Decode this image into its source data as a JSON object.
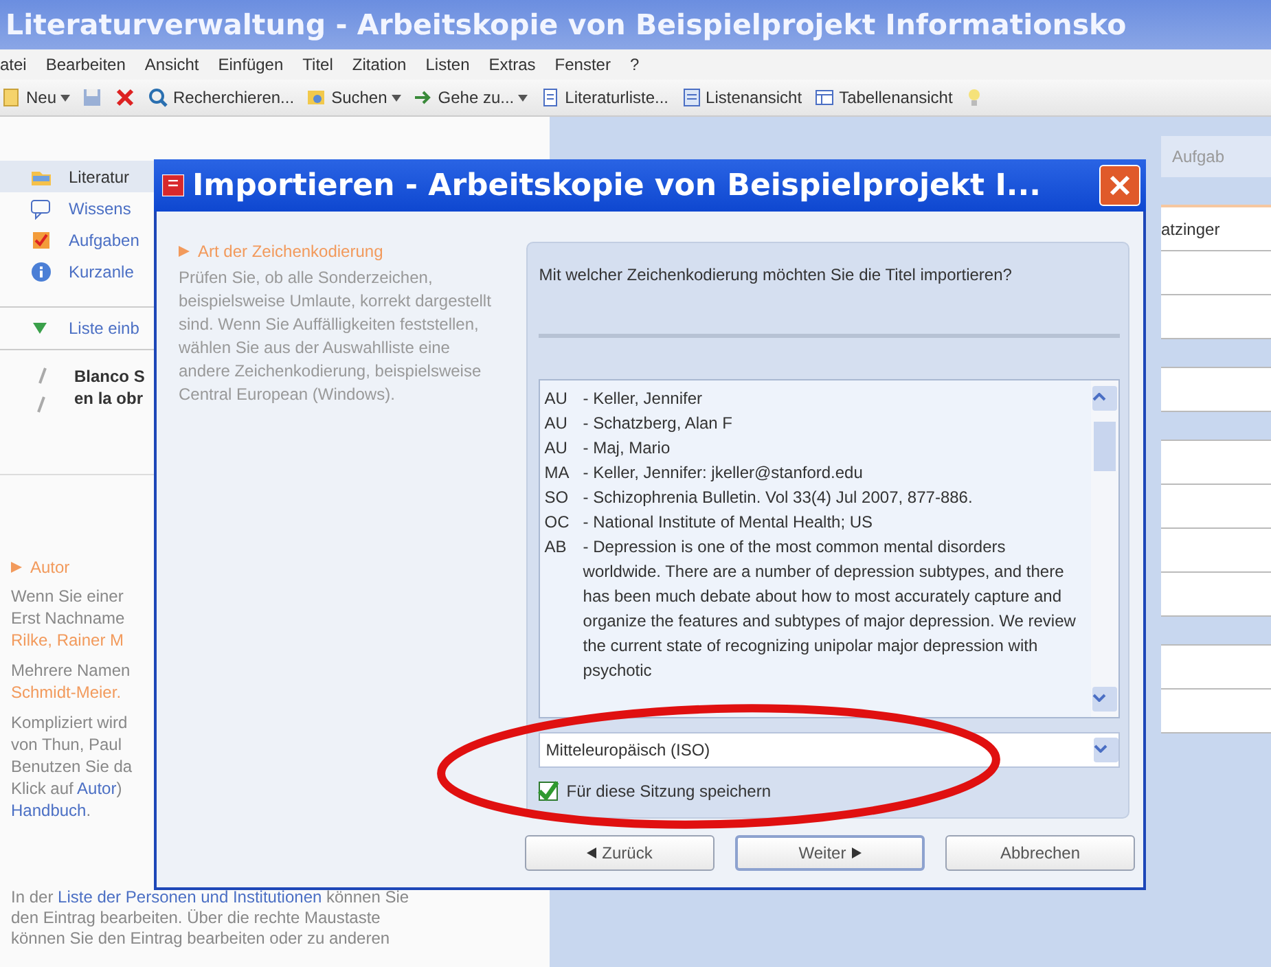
{
  "window": {
    "title": "Literaturverwaltung - Arbeitskopie von Beispielprojekt Informationsko"
  },
  "menu": [
    "atei",
    "Bearbeiten",
    "Ansicht",
    "Einfügen",
    "Titel",
    "Zitation",
    "Listen",
    "Extras",
    "Fenster",
    "?"
  ],
  "toolbar": [
    {
      "kind": "new",
      "label": "Neu",
      "dropdown": true
    },
    {
      "kind": "save"
    },
    {
      "kind": "delete"
    },
    {
      "kind": "search",
      "label": "Recherchieren...",
      "dropdown": false
    },
    {
      "kind": "find",
      "label": "Suchen",
      "dropdown": true
    },
    {
      "kind": "goto",
      "label": "Gehe zu...",
      "dropdown": true
    },
    {
      "kind": "list",
      "label": "Literaturliste...",
      "dropdown": false
    },
    {
      "kind": "listview",
      "label": "Listenansicht",
      "dropdown": false
    },
    {
      "kind": "table",
      "label": "Tabellenansicht",
      "dropdown": false
    },
    {
      "kind": "tip"
    }
  ],
  "sidebar": {
    "items": [
      {
        "kind": "literature",
        "label": "Literatur",
        "selected": true
      },
      {
        "kind": "knowledge",
        "label": "Wissens",
        "selected": false
      },
      {
        "kind": "tasks",
        "label": "Aufgaben",
        "selected": false
      },
      {
        "kind": "info",
        "label": "Kurzanle",
        "selected": false
      }
    ],
    "list_header": "Liste einb",
    "entry": {
      "lines": [
        "Blanco S",
        "en la obr"
      ]
    }
  },
  "help": {
    "heading": "Autor",
    "paragraphs": [
      [
        [
          {
            "kind": "text",
            "text": "Wenn Sie einer"
          }
        ],
        [
          {
            "kind": "text",
            "text": "Erst Nachname"
          }
        ],
        [
          {
            "kind": "example",
            "text": "Rilke, Rainer M"
          }
        ]
      ],
      [
        [
          {
            "kind": "text",
            "text": "Mehrere Namen"
          }
        ],
        [
          {
            "kind": "example",
            "text": "Schmidt-Meier."
          }
        ]
      ],
      [
        [
          {
            "kind": "text",
            "text": "Kompliziert wird"
          }
        ],
        [
          {
            "kind": "text",
            "text": "von Thun, Paul"
          }
        ],
        [
          {
            "kind": "text",
            "text": "Benutzen Sie da"
          }
        ],
        [
          {
            "kind": "text",
            "text": "Klick auf "
          },
          {
            "kind": "link",
            "text": "Autor"
          },
          {
            "kind": "text",
            "text": ")"
          }
        ],
        [
          {
            "kind": "link",
            "text": "Handbuch"
          },
          {
            "kind": "text",
            "text": "."
          }
        ]
      ]
    ],
    "footer": [
      [
        {
          "kind": "text",
          "text": "In der "
        },
        {
          "kind": "link",
          "text": "Liste der Personen und Institutionen"
        },
        {
          "kind": "text",
          "text": " können Sie"
        }
      ],
      [
        {
          "kind": "text",
          "text": "den Eintrag bearbeiten. Über die rechte Maustaste"
        }
      ],
      [
        {
          "kind": "text",
          "text": "können Sie den Eintrag bearbeiten oder zu anderen"
        }
      ]
    ]
  },
  "background_pane": {
    "tab": "Aufgab",
    "cell": "atzinger"
  },
  "dialog": {
    "title": "Importieren - Arbeitskopie von Beispielprojekt I...",
    "step": "Art der Zeichenkodierung",
    "help": "Prüfen Sie, ob alle Sonderzeichen, beispielsweise Umlaute, korrekt dargestellt sind. Wenn Sie Auffälligkeiten feststellen, wählen Sie aus der Auswahlliste eine andere Zeichenkodierung, beispielsweise Central European (Windows).",
    "question": "Mit welcher Zeichenkodierung möchten Sie die Titel importieren?",
    "preview": [
      {
        "tag": "AU",
        "text": "- Keller, Jennifer"
      },
      {
        "tag": "AU",
        "text": "- Schatzberg, Alan F"
      },
      {
        "tag": "AU",
        "text": "- Maj, Mario"
      },
      {
        "tag": "MA",
        "text": "- Keller, Jennifer: jkeller@stanford.edu"
      },
      {
        "tag": "SO",
        "text": "- Schizophrenia Bulletin. Vol 33(4) Jul 2007, 877-886."
      },
      {
        "tag": "OC",
        "text": "- National Institute of Mental Health; US"
      },
      {
        "tag": "AB",
        "text": "- Depression is one of the most common mental disorders worldwide. There are a number of depression subtypes, and there has been much debate about how to most accurately capture and organize the features and subtypes of major depression. We review the current state of recognizing unipolar major depression with psychotic"
      }
    ],
    "encoding": "Mitteleuropäisch (ISO)",
    "save_session": {
      "label": "Für diese Sitzung speichern",
      "checked": true
    },
    "buttons": [
      {
        "kind": "back",
        "label": "Zurück",
        "default": false
      },
      {
        "kind": "next",
        "label": "Weiter",
        "default": true
      },
      {
        "kind": "cancel",
        "label": "Abbrechen",
        "default": false
      }
    ]
  }
}
